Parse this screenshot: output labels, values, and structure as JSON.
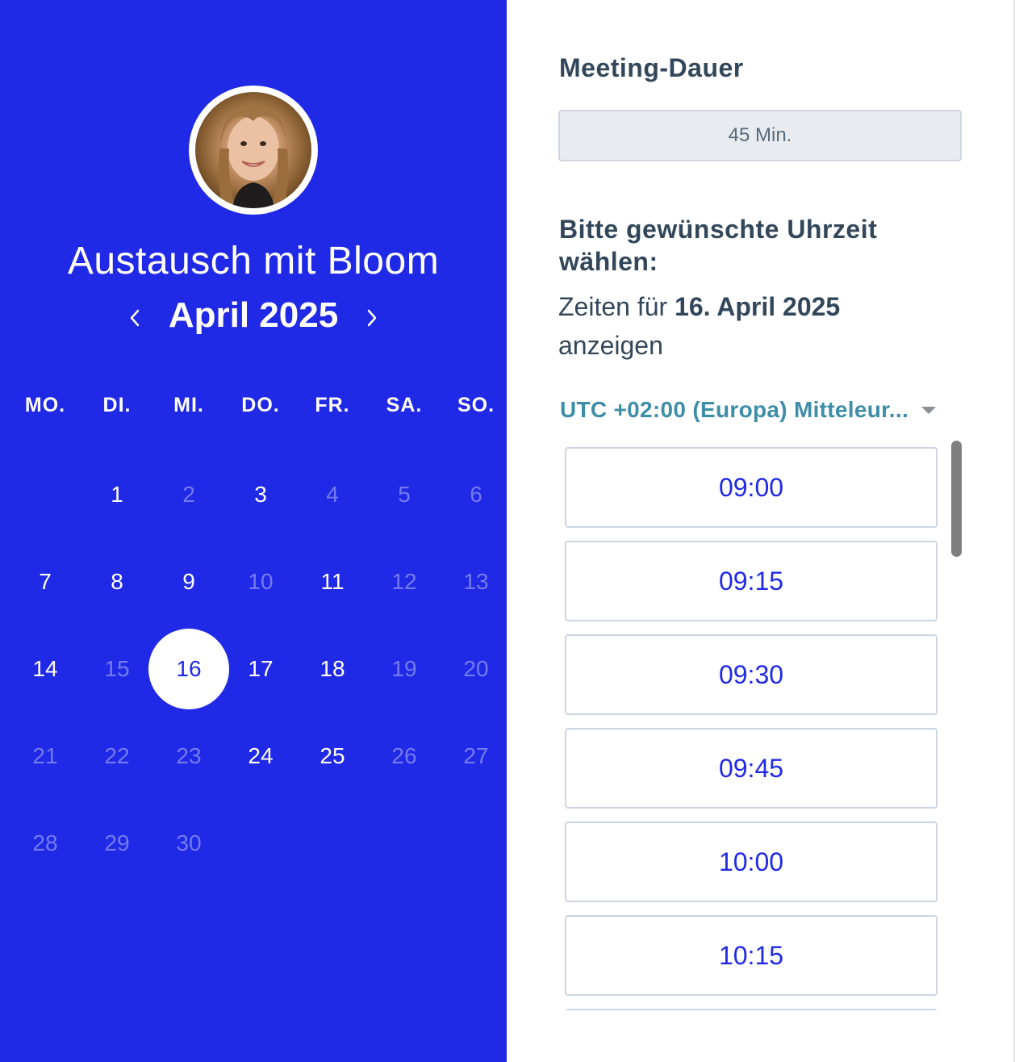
{
  "calendar": {
    "meeting_title": "Austausch mit Bloom",
    "month_label": "April 2025",
    "prev_icon": "chevron-left-icon",
    "next_icon": "chevron-right-icon",
    "weekdays": [
      "MO.",
      "DI.",
      "MI.",
      "DO.",
      "FR.",
      "SA.",
      "SO."
    ],
    "selected_day": "16",
    "weeks": [
      [
        null,
        {
          "d": "1",
          "s": "available"
        },
        {
          "d": "2",
          "s": "unavailable"
        },
        {
          "d": "3",
          "s": "available"
        },
        {
          "d": "4",
          "s": "unavailable"
        },
        {
          "d": "5",
          "s": "unavailable"
        },
        {
          "d": "6",
          "s": "unavailable"
        }
      ],
      [
        {
          "d": "7",
          "s": "available"
        },
        {
          "d": "8",
          "s": "available"
        },
        {
          "d": "9",
          "s": "available"
        },
        {
          "d": "10",
          "s": "unavailable"
        },
        {
          "d": "11",
          "s": "available"
        },
        {
          "d": "12",
          "s": "unavailable"
        },
        {
          "d": "13",
          "s": "unavailable"
        }
      ],
      [
        {
          "d": "14",
          "s": "available"
        },
        {
          "d": "15",
          "s": "unavailable"
        },
        {
          "d": "16",
          "s": "selected"
        },
        {
          "d": "17",
          "s": "available"
        },
        {
          "d": "18",
          "s": "available"
        },
        {
          "d": "19",
          "s": "unavailable"
        },
        {
          "d": "20",
          "s": "unavailable"
        }
      ],
      [
        {
          "d": "21",
          "s": "unavailable"
        },
        {
          "d": "22",
          "s": "unavailable"
        },
        {
          "d": "23",
          "s": "unavailable"
        },
        {
          "d": "24",
          "s": "available"
        },
        {
          "d": "25",
          "s": "available"
        },
        {
          "d": "26",
          "s": "unavailable"
        },
        {
          "d": "27",
          "s": "unavailable"
        }
      ],
      [
        {
          "d": "28",
          "s": "unavailable"
        },
        {
          "d": "29",
          "s": "unavailable"
        },
        {
          "d": "30",
          "s": "unavailable"
        },
        null,
        null,
        null,
        null
      ]
    ]
  },
  "booking": {
    "duration_heading": "Meeting-Dauer",
    "duration_value": "45 Min.",
    "time_heading": "Bitte gewünschte Uhrzeit wählen:",
    "date_prefix": "Zeiten für ",
    "date_bold": "16. April 2025",
    "date_suffix": "anzeigen",
    "timezone": "UTC +02:00 (Europa) Mitteleur...",
    "time_slots": [
      "09:00",
      "09:15",
      "09:30",
      "09:45",
      "10:00",
      "10:15"
    ]
  },
  "colors": {
    "brand_blue": "#2029e6",
    "text_dark": "#33475b",
    "timezone_teal": "#3e8ea8"
  }
}
